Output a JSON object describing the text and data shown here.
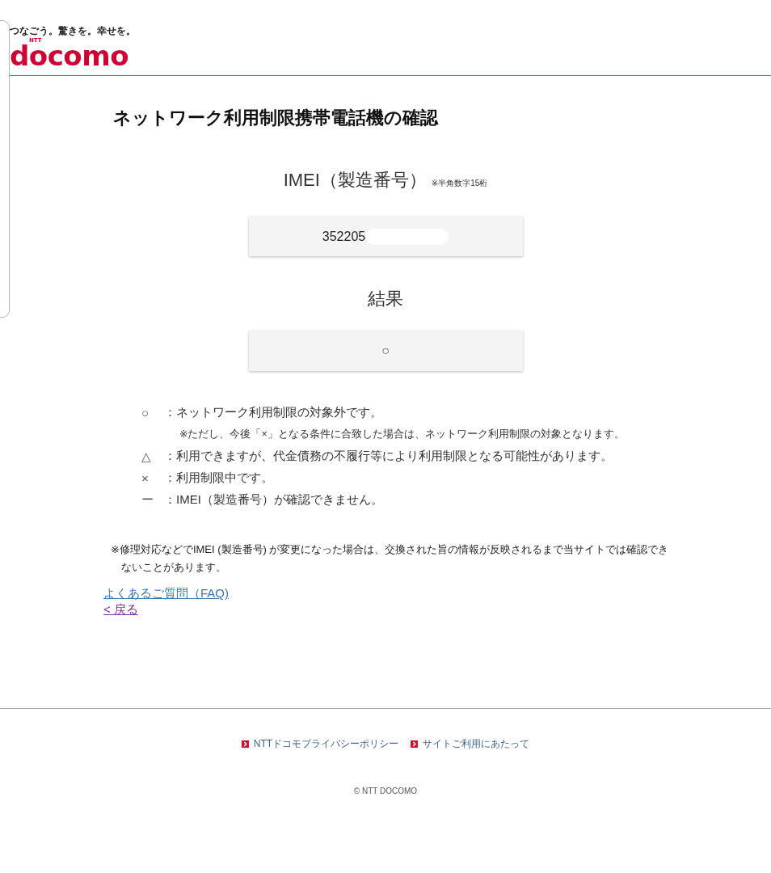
{
  "header": {
    "tagline": "つなごう。驚きを。幸せを。",
    "logo": {
      "superscript": "NTT",
      "wordmark": "docomo"
    }
  },
  "page_title": "ネットワーク利用制限携帯電話機の確認",
  "imei": {
    "label": "IMEI（製造番号）",
    "hint": "※半角数字15桁",
    "value": "352205",
    "redacted": true
  },
  "result": {
    "label": "結果",
    "value": "○"
  },
  "legend": [
    {
      "kind": "entry",
      "mark": "○",
      "separator": "：",
      "text": "ネットワーク利用制限の対象外です。"
    },
    {
      "kind": "note",
      "text": "※ただし、今後「×」となる条件に合致した場合は、ネットワーク利用制限の対象となります。"
    },
    {
      "kind": "entry",
      "mark": "△",
      "separator": "：",
      "text": "利用できますが、代金債務の不履行等により利用制限となる可能性があります。"
    },
    {
      "kind": "entry",
      "mark": "×",
      "separator": "：",
      "text": "利用制限中です。"
    },
    {
      "kind": "entry",
      "mark": "ー",
      "separator": "：",
      "text": "IMEI（製造番号）が確認できません。"
    }
  ],
  "notice": "※修理対応などでIMEI (製造番号) が変更になった場合は、交換された旨の情報が反映されるまで当サイトでは確認できないことがあります。",
  "links": [
    {
      "label": "よくあるご質問（FAQ)",
      "visited": false
    },
    {
      "label": "< 戻る",
      "visited": true
    }
  ],
  "footer": {
    "links": [
      "NTTドコモプライバシーポリシー",
      "サイトご利用にあたって"
    ],
    "copyright": "© NTT DOCOMO"
  }
}
